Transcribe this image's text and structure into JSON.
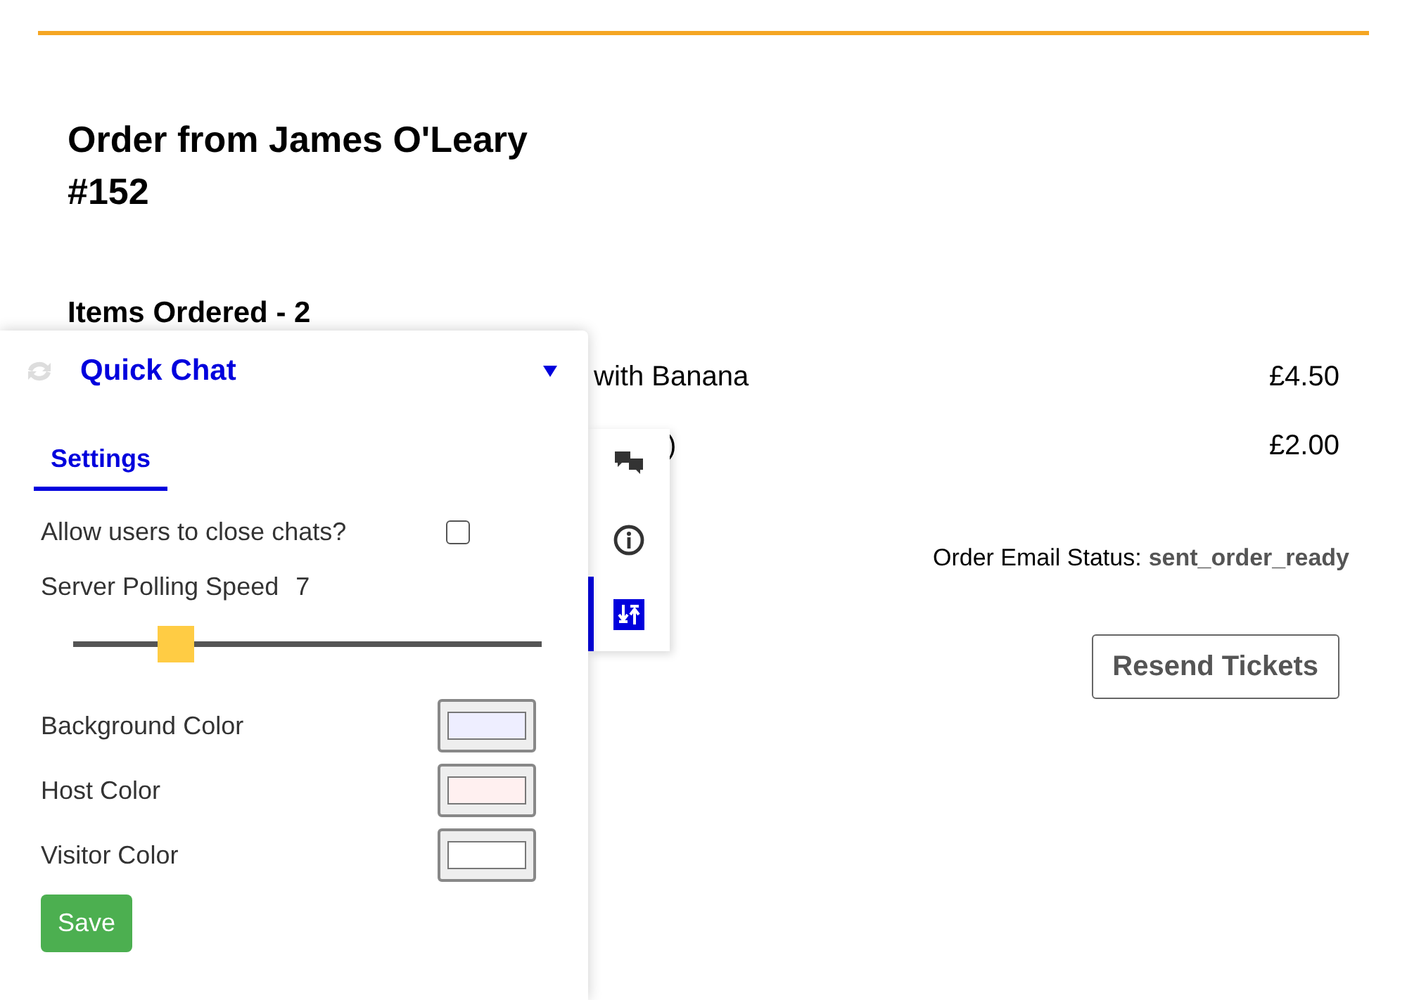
{
  "order": {
    "title": "Order from James O'Leary #152",
    "items_heading": "Items Ordered - 2",
    "items": [
      {
        "name": "with Banana",
        "price": "£4.50"
      },
      {
        "name": ")",
        "price": "£2.00"
      }
    ],
    "email_status_label": "Order Email Status:",
    "email_status": "sent_order_ready",
    "resend_button": "Resend Tickets"
  },
  "chat_panel": {
    "title": "Quick Chat",
    "tabs": [
      {
        "label": "Settings",
        "selected": true
      }
    ],
    "allow_close": {
      "label": "Allow users to close chats?",
      "checked": false
    },
    "polling": {
      "label": "Server Polling Speed",
      "value": "7",
      "level": 0.22
    },
    "colors": [
      {
        "label": "Background Color",
        "color": "#eeeeff"
      },
      {
        "label": "Host Color",
        "color": "#fff0f0"
      },
      {
        "label": "Visitor Color",
        "color": "#ffffff"
      }
    ],
    "save_button": "Save"
  },
  "rail": [
    {
      "kind": "chats",
      "selected": false
    },
    {
      "kind": "info",
      "selected": false
    },
    {
      "kind": "settings",
      "selected": true
    }
  ]
}
